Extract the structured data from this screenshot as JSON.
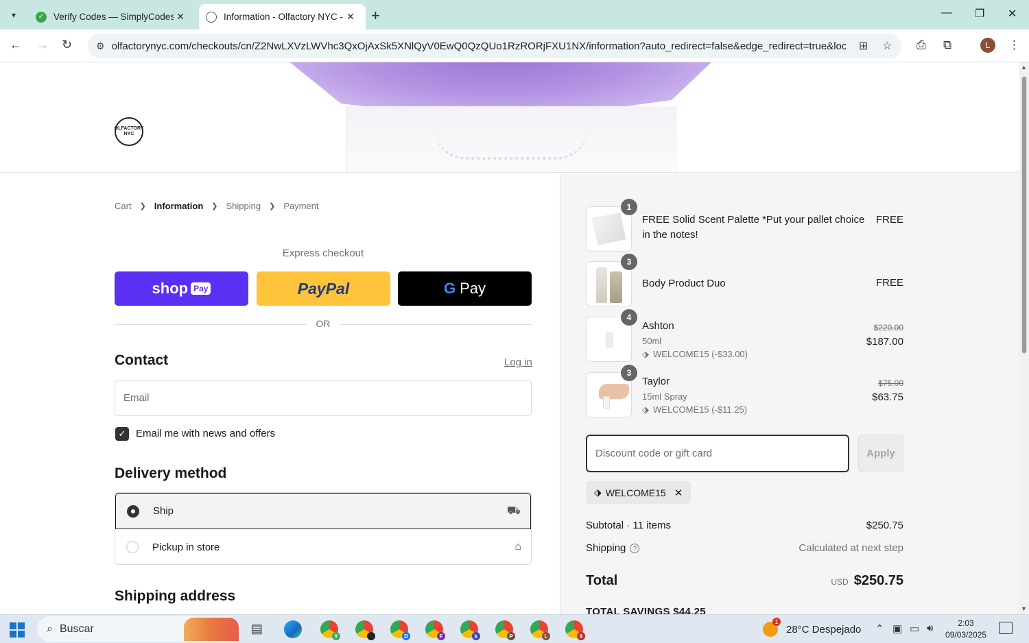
{
  "browser": {
    "tabs": [
      {
        "title": "Verify Codes — SimplyCodes",
        "active": false
      },
      {
        "title": "Information - Olfactory NYC - C",
        "active": true
      }
    ],
    "url": "olfactorynyc.com/checkouts/cn/Z2NwLXVzLWVhc3QxOjAxSk5XNlQyV0EwQ0QzQUo1RzRORjFXU1NX/information?auto_redirect=false&edge_redirect=true&locale=e...",
    "avatar_letter": "L"
  },
  "header": {
    "logo_text": "OLFACTORY NYC"
  },
  "breadcrumb": [
    "Cart",
    "Information",
    "Shipping",
    "Payment"
  ],
  "express": {
    "title": "Express checkout",
    "shop_label": "shop",
    "shop_pay_pill": "Pay",
    "paypal_label": "PayPal",
    "gpay_g": "G",
    "gpay_label": "Pay",
    "or_text": "OR"
  },
  "contact": {
    "heading": "Contact",
    "login_link": "Log in",
    "email_placeholder": "Email",
    "newsletter_label": "Email me with news and offers",
    "newsletter_checked": true
  },
  "delivery": {
    "heading": "Delivery method",
    "options": [
      {
        "label": "Ship",
        "selected": true
      },
      {
        "label": "Pickup in store",
        "selected": false
      }
    ]
  },
  "shipping_address": {
    "heading": "Shipping address"
  },
  "order": {
    "items": [
      {
        "qty": "1",
        "name": "FREE Solid Scent Palette *Put your pallet choice in the notes!",
        "variant": "",
        "discount": "",
        "old_price": "",
        "price": "FREE"
      },
      {
        "qty": "3",
        "name": "Body Product Duo",
        "variant": "",
        "discount": "",
        "old_price": "",
        "price": "FREE"
      },
      {
        "qty": "4",
        "name": "Ashton",
        "variant": "50ml",
        "discount": "WELCOME15 (-$33.00)",
        "old_price": "$220.00",
        "price": "$187.00"
      },
      {
        "qty": "3",
        "name": "Taylor",
        "variant": "15ml Spray",
        "discount": "WELCOME15 (-$11.25)",
        "old_price": "$75.00",
        "price": "$63.75"
      }
    ],
    "discount_placeholder": "Discount code or gift card",
    "apply_label": "Apply",
    "applied_code": "WELCOME15",
    "subtotal_label": "Subtotal · 11 items",
    "subtotal_value": "$250.75",
    "shipping_label": "Shipping",
    "shipping_value": "Calculated at next step",
    "total_label": "Total",
    "total_currency": "USD",
    "total_value": "$250.75",
    "savings_label": "TOTAL SAVINGS  $44.25"
  },
  "taskbar": {
    "search_label": "Buscar",
    "weather_alert": "1",
    "weather": "28°C  Despejado",
    "time": "2:03",
    "date": "09/03/2025",
    "chrome_badges": [
      "Y",
      "",
      "D",
      "F",
      "k",
      "P",
      "L",
      "9"
    ]
  }
}
